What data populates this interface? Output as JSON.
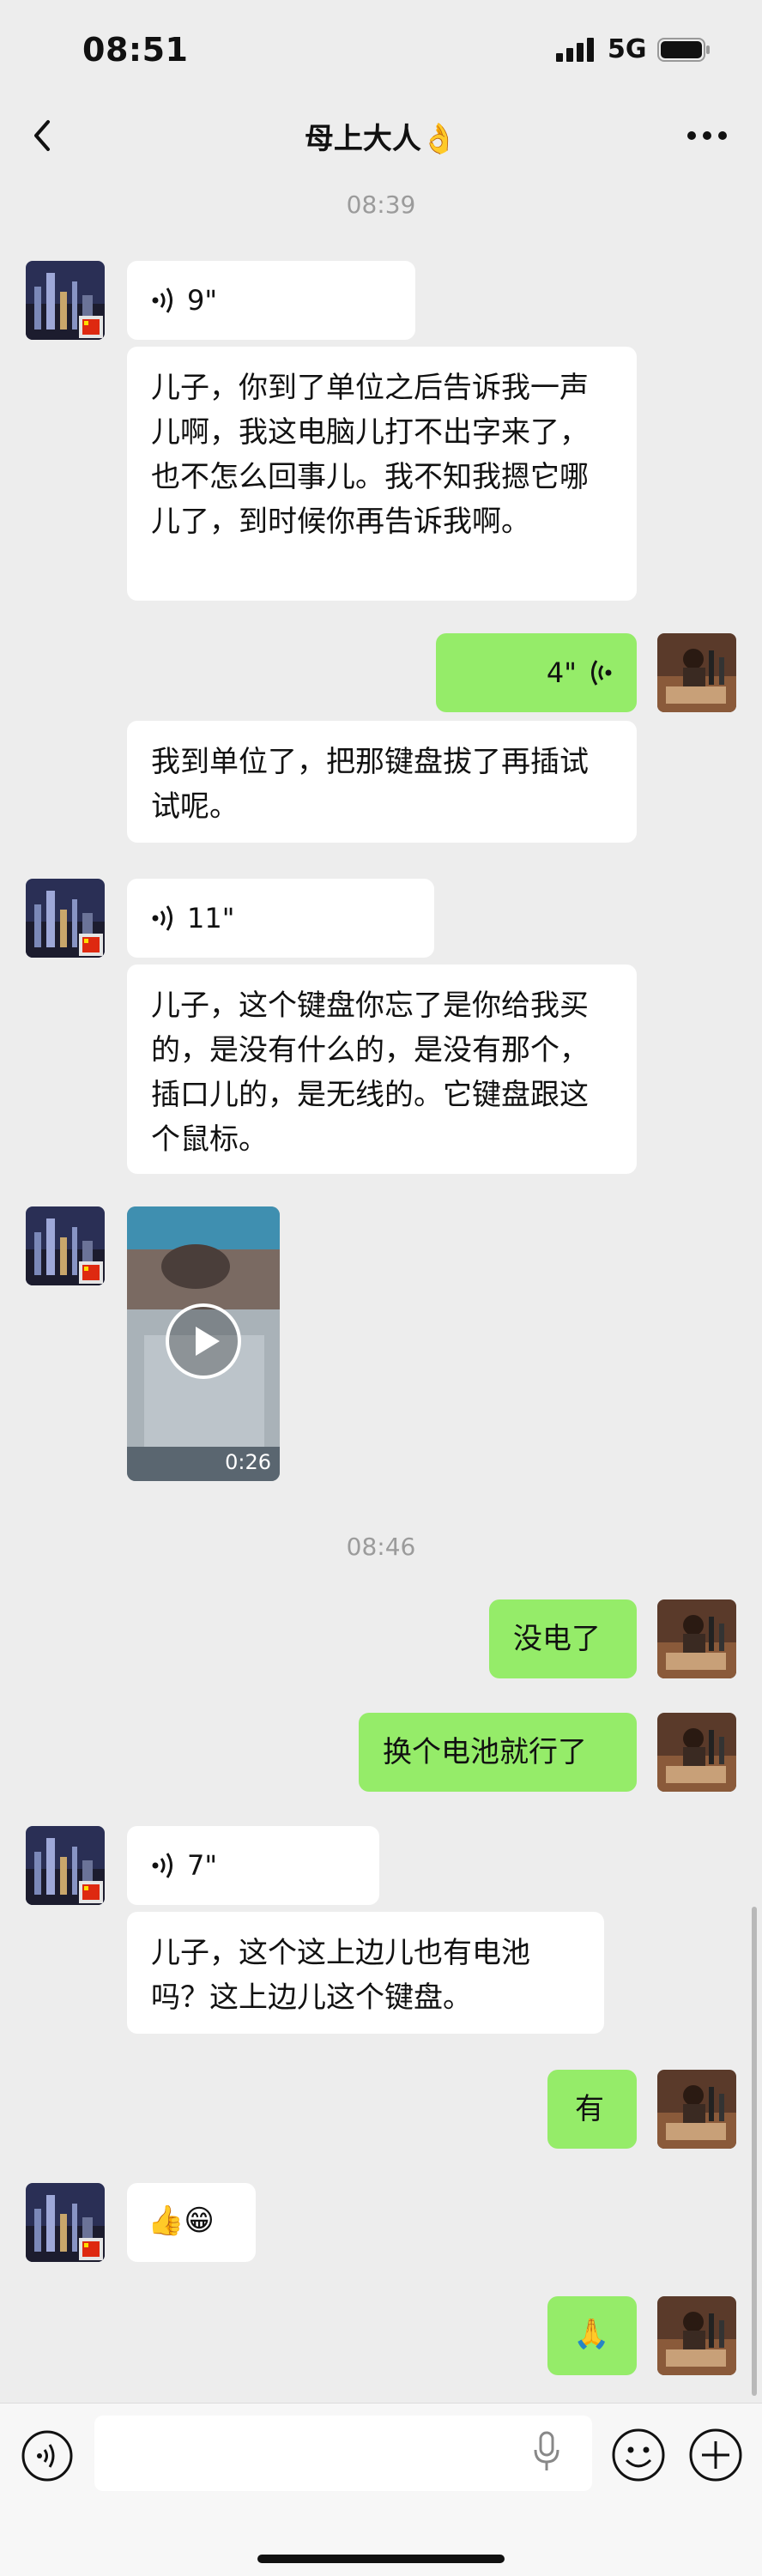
{
  "status_bar": {
    "time": "08:51",
    "network": "5G"
  },
  "nav": {
    "title": "母上大人👌"
  },
  "timestamps": [
    "08:39",
    "08:46"
  ],
  "messages": [
    {
      "sender": "mom",
      "type": "voice",
      "duration": "9\""
    },
    {
      "sender": "mom",
      "type": "text",
      "text": "儿子，你到了单位之后告诉我一声儿啊，我这电脑儿打不出字来了，也不怎么回事儿。我不知我摁它哪儿了，到时候你再告诉我啊。"
    },
    {
      "sender": "me",
      "type": "voice",
      "duration": "4\""
    },
    {
      "sender": "mom",
      "type": "text",
      "text": "我到单位了，把那键盘拔了再插试试呢。"
    },
    {
      "sender": "mom",
      "type": "voice",
      "duration": "11\""
    },
    {
      "sender": "mom",
      "type": "text",
      "text": "儿子，这个键盘你忘了是你给我买的，是没有什么的，是没有那个，插口儿的，是无线的。它键盘跟这个鼠标。"
    },
    {
      "sender": "mom",
      "type": "video",
      "duration": "0:26"
    },
    {
      "sender": "me",
      "type": "text",
      "text": "没电了"
    },
    {
      "sender": "me",
      "type": "text",
      "text": "换个电池就行了"
    },
    {
      "sender": "mom",
      "type": "voice",
      "duration": "7\""
    },
    {
      "sender": "mom",
      "type": "text",
      "text": "儿子，这个这上边儿也有电池吗？这上边儿这个键盘。"
    },
    {
      "sender": "me",
      "type": "text",
      "text": "有"
    },
    {
      "sender": "mom",
      "type": "emoji",
      "text": "👍😁"
    },
    {
      "sender": "me",
      "type": "emoji",
      "text": "🙏"
    }
  ],
  "input": {
    "placeholder": ""
  },
  "icons": {
    "back": "chevron-left-icon",
    "more": "ellipsis-icon",
    "voice": "voice-wave-icon",
    "mic": "microphone-icon",
    "emoji": "smiley-icon",
    "plus": "plus-circle-icon",
    "play": "play-icon"
  },
  "colors": {
    "background": "#ededed",
    "bubble_in": "#ffffff",
    "bubble_out": "#95ec69",
    "timestamp": "#9b9b9b"
  }
}
